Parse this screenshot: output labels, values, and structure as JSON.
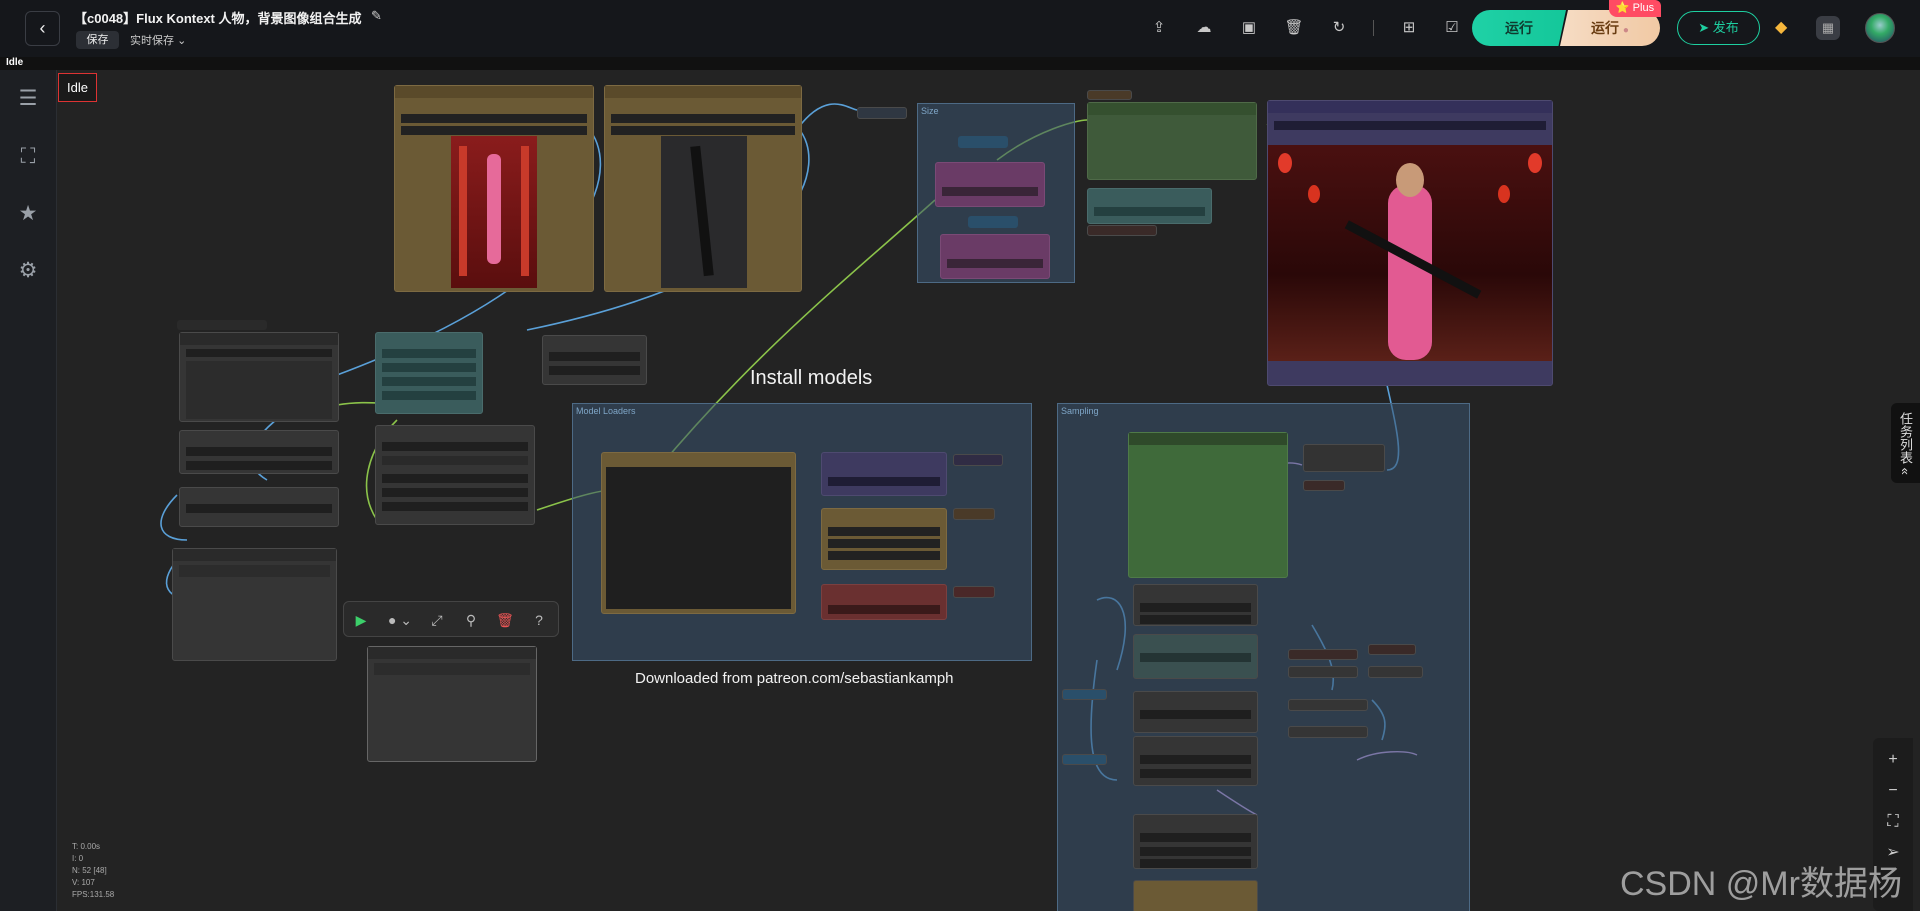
{
  "topbar": {
    "back_icon": "chevron-left-icon",
    "title": "【c0048】Flux Kontext 人物，背景图像组合生成",
    "save_label": "保存",
    "autosave_label": "实时保存",
    "run_label": "运行",
    "run_plus_label": "运行",
    "plus_badge": "⭐ Plus",
    "publish_label": "发布",
    "icons": [
      "upload-icon",
      "cloud-download-icon",
      "image-icon",
      "trash-icon",
      "refresh-icon",
      "grid-icon",
      "checklist-icon"
    ]
  },
  "status_strip": {
    "label": "Idle"
  },
  "sidebar": {
    "items": [
      "document-list-icon",
      "hierarchy-icon",
      "star-icon",
      "settings-gear-icon"
    ]
  },
  "canvas": {
    "status": "Idle",
    "install_text": "Install models",
    "download_text": "Downloaded from patreon.com/sebastiankamph",
    "groups": {
      "size": "Size",
      "model_loaders": "Model Loaders",
      "sampling": "Sampling"
    },
    "stats": [
      "T: 0.00s",
      "I: 0",
      "N: 52 [48]",
      "V: 107",
      "FPS:131.58"
    ]
  },
  "task_list_label": "任务列表",
  "watermark": "CSDN @Mr数据杨",
  "colors": {
    "accent_green": "#1fd1a6",
    "accent_orange": "#f1c9a4",
    "badge_red": "#ff4b63",
    "wire_blue": "#5aa0d8",
    "wire_green": "#8bc34a"
  }
}
